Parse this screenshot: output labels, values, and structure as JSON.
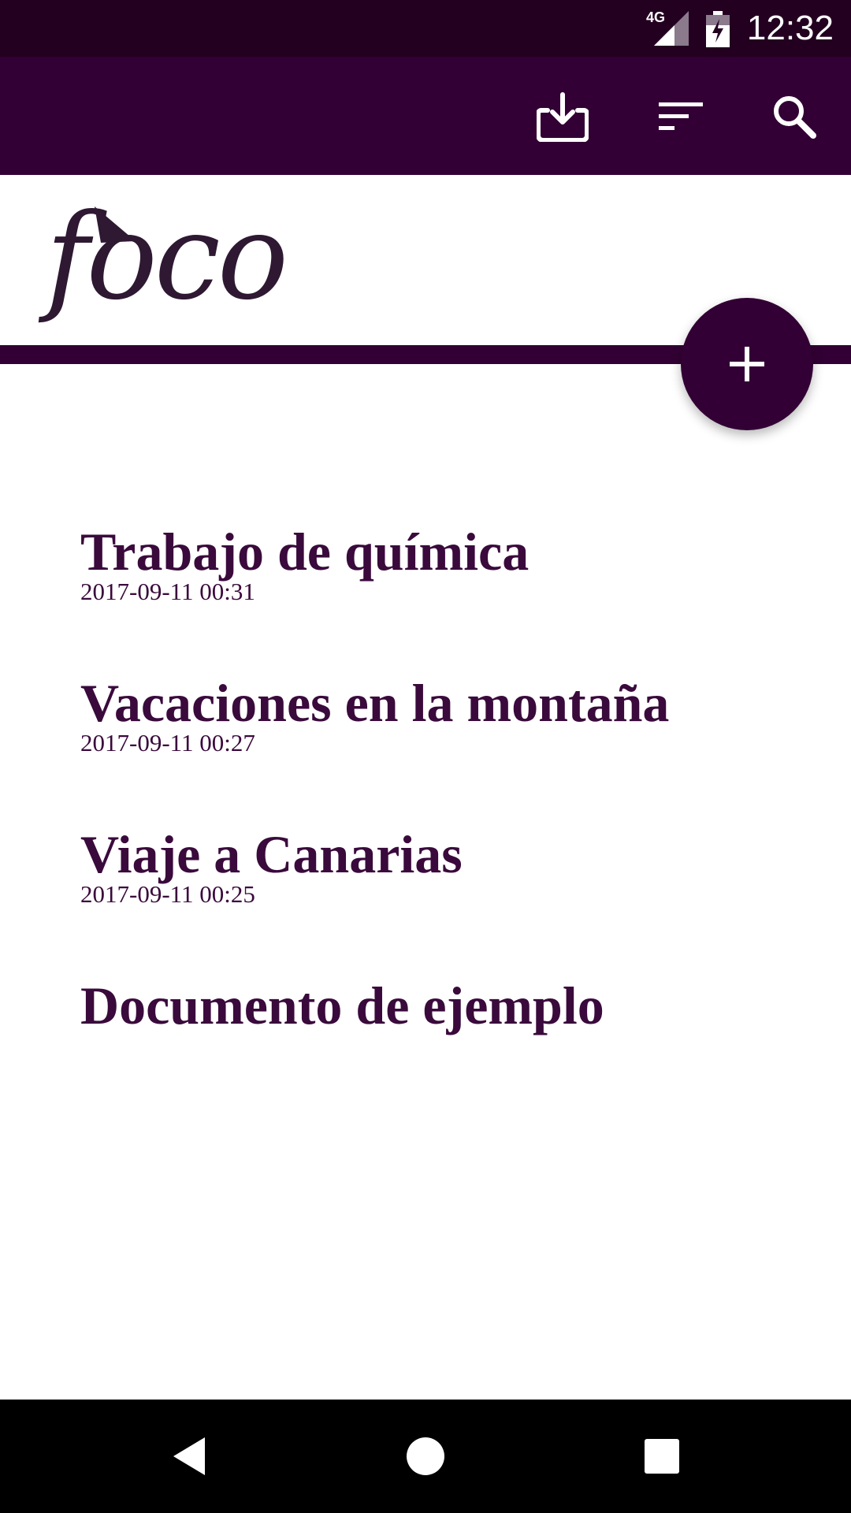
{
  "status_bar": {
    "network": "4G",
    "time": "12:32"
  },
  "app_bar": {
    "icons": [
      "download-icon",
      "sort-icon",
      "search-icon"
    ]
  },
  "header": {
    "logo_text": "foco"
  },
  "fab": {
    "icon": "plus-icon"
  },
  "documents": [
    {
      "title": "Trabajo de química",
      "date": "2017-09-11 00:31"
    },
    {
      "title": "Vacaciones en la montaña",
      "date": "2017-09-11 00:27"
    },
    {
      "title": "Viaje a Canarias",
      "date": "2017-09-11 00:25"
    },
    {
      "title": "Documento de ejemplo",
      "date": ""
    }
  ],
  "nav_bar": {
    "icons": [
      "back-icon",
      "home-icon",
      "recents-icon"
    ]
  },
  "colors": {
    "primary": "#320034",
    "status_bar": "#230020",
    "text": "#3a0a3c"
  }
}
